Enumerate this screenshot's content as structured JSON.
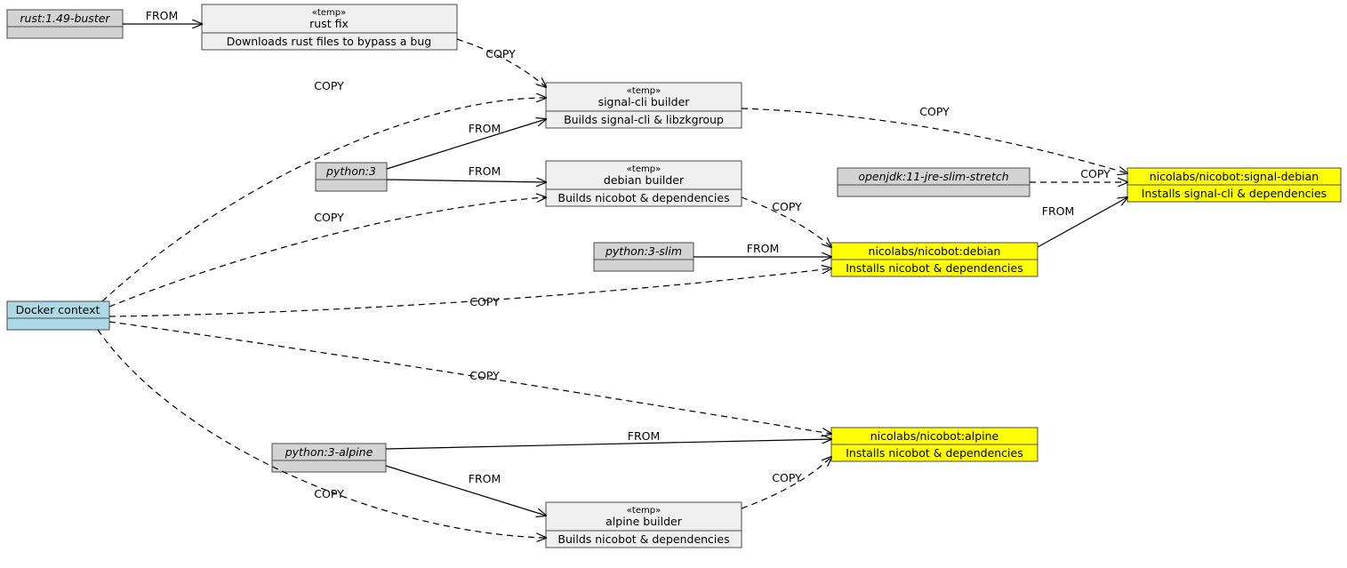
{
  "labels": {
    "from": "FROM",
    "copy": "COPY"
  },
  "nodes": {
    "docker_context": {
      "title": "Docker context"
    },
    "rust": {
      "title": "rust:1.49-buster"
    },
    "python3": {
      "title": "python:3"
    },
    "python3slim": {
      "title": "python:3-slim"
    },
    "python3alpine": {
      "title": "python:3-alpine"
    },
    "openjdk": {
      "title": "openjdk:11-jre-slim-stretch"
    },
    "rust_fix": {
      "stereo": "«temp»",
      "title": "rust fix",
      "desc": "Downloads rust files to bypass a bug"
    },
    "signal_builder": {
      "stereo": "«temp»",
      "title": "signal-cli builder",
      "desc": "Builds signal-cli & libzkgroup"
    },
    "debian_builder": {
      "stereo": "«temp»",
      "title": "debian builder",
      "desc": "Builds nicobot & dependencies"
    },
    "alpine_builder": {
      "stereo": "«temp»",
      "title": "alpine builder",
      "desc": "Builds nicobot & dependencies"
    },
    "out_signal_debian": {
      "title": "nicolabs/nicobot:signal-debian",
      "desc": "Installs signal-cli & dependencies"
    },
    "out_debian": {
      "title": "nicolabs/nicobot:debian",
      "desc": "Installs nicobot & dependencies"
    },
    "out_alpine": {
      "title": "nicolabs/nicobot:alpine",
      "desc": "Installs nicobot & dependencies"
    }
  },
  "chart_data": {
    "type": "diagram",
    "title": "Docker multi-stage build dependency graph",
    "nodes": [
      {
        "id": "docker_context",
        "kind": "context",
        "label": "Docker context"
      },
      {
        "id": "rust",
        "kind": "base-image",
        "label": "rust:1.49-buster"
      },
      {
        "id": "python3",
        "kind": "base-image",
        "label": "python:3"
      },
      {
        "id": "python3slim",
        "kind": "base-image",
        "label": "python:3-slim"
      },
      {
        "id": "python3alpine",
        "kind": "base-image",
        "label": "python:3-alpine"
      },
      {
        "id": "openjdk",
        "kind": "base-image",
        "label": "openjdk:11-jre-slim-stretch"
      },
      {
        "id": "rust_fix",
        "kind": "temp-stage",
        "label": "rust fix",
        "desc": "Downloads rust files to bypass a bug"
      },
      {
        "id": "signal_builder",
        "kind": "temp-stage",
        "label": "signal-cli builder",
        "desc": "Builds signal-cli & libzkgroup"
      },
      {
        "id": "debian_builder",
        "kind": "temp-stage",
        "label": "debian builder",
        "desc": "Builds nicobot & dependencies"
      },
      {
        "id": "alpine_builder",
        "kind": "temp-stage",
        "label": "alpine builder",
        "desc": "Builds nicobot & dependencies"
      },
      {
        "id": "out_signal_debian",
        "kind": "output-image",
        "label": "nicolabs/nicobot:signal-debian",
        "desc": "Installs signal-cli & dependencies"
      },
      {
        "id": "out_debian",
        "kind": "output-image",
        "label": "nicolabs/nicobot:debian",
        "desc": "Installs nicobot & dependencies"
      },
      {
        "id": "out_alpine",
        "kind": "output-image",
        "label": "nicolabs/nicobot:alpine",
        "desc": "Installs nicobot & dependencies"
      }
    ],
    "edges": [
      {
        "from": "rust",
        "to": "rust_fix",
        "label": "FROM",
        "style": "solid"
      },
      {
        "from": "rust_fix",
        "to": "signal_builder",
        "label": "COPY",
        "style": "dashed"
      },
      {
        "from": "docker_context",
        "to": "signal_builder",
        "label": "COPY",
        "style": "dashed"
      },
      {
        "from": "python3",
        "to": "signal_builder",
        "label": "FROM",
        "style": "solid"
      },
      {
        "from": "python3",
        "to": "debian_builder",
        "label": "FROM",
        "style": "solid"
      },
      {
        "from": "docker_context",
        "to": "debian_builder",
        "label": "COPY",
        "style": "dashed"
      },
      {
        "from": "signal_builder",
        "to": "out_signal_debian",
        "label": "COPY",
        "style": "dashed"
      },
      {
        "from": "openjdk",
        "to": "out_signal_debian",
        "label": "COPY",
        "style": "dashed"
      },
      {
        "from": "out_debian",
        "to": "out_signal_debian",
        "label": "FROM",
        "style": "solid"
      },
      {
        "from": "debian_builder",
        "to": "out_debian",
        "label": "COPY",
        "style": "dashed"
      },
      {
        "from": "python3slim",
        "to": "out_debian",
        "label": "FROM",
        "style": "solid"
      },
      {
        "from": "docker_context",
        "to": "out_debian",
        "label": "COPY",
        "style": "dashed"
      },
      {
        "from": "docker_context",
        "to": "out_alpine",
        "label": "COPY",
        "style": "dashed"
      },
      {
        "from": "python3alpine",
        "to": "out_alpine",
        "label": "FROM",
        "style": "solid"
      },
      {
        "from": "python3alpine",
        "to": "alpine_builder",
        "label": "FROM",
        "style": "solid"
      },
      {
        "from": "alpine_builder",
        "to": "out_alpine",
        "label": "COPY",
        "style": "dashed"
      },
      {
        "from": "docker_context",
        "to": "alpine_builder",
        "label": "COPY",
        "style": "dashed"
      }
    ]
  }
}
